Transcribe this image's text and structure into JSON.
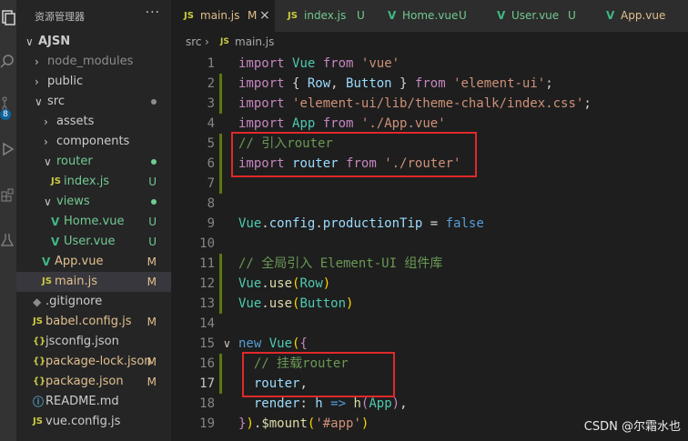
{
  "sidebar": {
    "title": "资源管理器",
    "more_glyph": "···",
    "badge": "8",
    "items": [
      {
        "label": "AJSN",
        "chev": "∨",
        "indent": 0,
        "bold": true
      },
      {
        "label": "node_modules",
        "chev": "›",
        "indent": 1,
        "dim": true
      },
      {
        "label": "public",
        "chev": "›",
        "indent": 1
      },
      {
        "label": "src",
        "chev": "∨",
        "indent": 1,
        "dot": "#8c8c8c"
      },
      {
        "label": "assets",
        "chev": "›",
        "indent": 2
      },
      {
        "label": "components",
        "chev": "›",
        "indent": 2
      },
      {
        "label": "router",
        "chev": "∨",
        "indent": 2,
        "dot": "#73c991",
        "color": "u"
      },
      {
        "label": "index.js",
        "icon": "JS",
        "indent": 3,
        "badge": "U",
        "color": "u"
      },
      {
        "label": "views",
        "chev": "∨",
        "indent": 2,
        "dot": "#73c991",
        "color": "u"
      },
      {
        "label": "Home.vue",
        "icon": "V",
        "indent": 3,
        "badge": "U",
        "color": "u"
      },
      {
        "label": "User.vue",
        "icon": "V",
        "indent": 3,
        "badge": "U",
        "color": "u"
      },
      {
        "label": "App.vue",
        "icon": "V",
        "indent": 2,
        "badge": "M",
        "color": "m"
      },
      {
        "label": "main.js",
        "icon": "JS",
        "indent": 2,
        "badge": "M",
        "color": "m",
        "active": true
      },
      {
        "label": ".gitignore",
        "icon": "◆",
        "indent": 1
      },
      {
        "label": "babel.config.js",
        "icon": "JS",
        "indent": 1,
        "badge": "M",
        "color": "m"
      },
      {
        "label": "jsconfig.json",
        "icon": "{}",
        "indent": 1
      },
      {
        "label": "package-lock.json",
        "icon": "{}",
        "indent": 1,
        "badge": "M",
        "color": "m"
      },
      {
        "label": "package.json",
        "icon": "{}",
        "indent": 1,
        "badge": "M",
        "color": "m"
      },
      {
        "label": "README.md",
        "icon": "ⓘ",
        "indent": 1
      },
      {
        "label": "vue.config.js",
        "icon": "JS",
        "indent": 1
      }
    ]
  },
  "tabs": [
    {
      "label": "main.js",
      "icon": "JS",
      "badge": "M",
      "close": "×",
      "active": true
    },
    {
      "label": "index.js",
      "icon": "JS",
      "badge": "U"
    },
    {
      "label": "Home.vue",
      "icon": "V",
      "badge": "U"
    },
    {
      "label": "User.vue",
      "icon": "V",
      "badge": "U"
    },
    {
      "label": "App.vue",
      "icon": "V",
      "badge": ""
    }
  ],
  "breadcrumb": {
    "folder": "src",
    "sep": "›",
    "icon": "JS",
    "file": "main.js"
  },
  "code_lines": [
    [
      [
        "kw",
        "import"
      ],
      [
        "pun",
        " "
      ],
      [
        "typ",
        "Vue"
      ],
      [
        "pun",
        " "
      ],
      [
        "kw",
        "from"
      ],
      [
        "pun",
        " "
      ],
      [
        "str",
        "'vue'"
      ]
    ],
    [
      [
        "kw",
        "import"
      ],
      [
        "pun",
        " { "
      ],
      [
        "id",
        "Row"
      ],
      [
        "pun",
        ", "
      ],
      [
        "id",
        "Button"
      ],
      [
        "pun",
        " } "
      ],
      [
        "kw",
        "from"
      ],
      [
        "pun",
        " "
      ],
      [
        "str",
        "'element-ui'"
      ],
      [
        "pun",
        ";"
      ]
    ],
    [
      [
        "kw",
        "import"
      ],
      [
        "pun",
        " "
      ],
      [
        "str",
        "'element-ui/lib/theme-chalk/index.css'"
      ],
      [
        "pun",
        ";"
      ]
    ],
    [
      [
        "kw",
        "import"
      ],
      [
        "pun",
        " "
      ],
      [
        "typ",
        "App"
      ],
      [
        "pun",
        " "
      ],
      [
        "kw",
        "from"
      ],
      [
        "pun",
        " "
      ],
      [
        "str",
        "'./App.vue'"
      ]
    ],
    [
      [
        "com",
        "// 引入router"
      ]
    ],
    [
      [
        "kw",
        "import"
      ],
      [
        "pun",
        " "
      ],
      [
        "id",
        "router"
      ],
      [
        "pun",
        " "
      ],
      [
        "kw",
        "from"
      ],
      [
        "pun",
        " "
      ],
      [
        "str",
        "'./router'"
      ]
    ],
    [],
    [],
    [
      [
        "typ",
        "Vue"
      ],
      [
        "pun",
        "."
      ],
      [
        "id",
        "config"
      ],
      [
        "pun",
        "."
      ],
      [
        "id",
        "productionTip"
      ],
      [
        "pun",
        " = "
      ],
      [
        "kw2",
        "false"
      ]
    ],
    [],
    [
      [
        "com",
        "// 全局引入 Element-UI 组件库"
      ]
    ],
    [
      [
        "typ",
        "Vue"
      ],
      [
        "pun",
        "."
      ],
      [
        "fn",
        "use"
      ],
      [
        "brk",
        "("
      ],
      [
        "typ",
        "Row"
      ],
      [
        "brk",
        ")"
      ]
    ],
    [
      [
        "typ",
        "Vue"
      ],
      [
        "pun",
        "."
      ],
      [
        "fn",
        "use"
      ],
      [
        "brk",
        "("
      ],
      [
        "typ",
        "Button"
      ],
      [
        "brk",
        ")"
      ]
    ],
    [],
    [
      [
        "kw2",
        "new"
      ],
      [
        "pun",
        " "
      ],
      [
        "typ",
        "Vue"
      ],
      [
        "brk",
        "("
      ],
      [
        "kw",
        "{"
      ]
    ],
    [
      [
        "pun",
        "  "
      ],
      [
        "com",
        "// 挂载router"
      ]
    ],
    [
      [
        "pun",
        "  "
      ],
      [
        "id",
        "router"
      ],
      [
        "pun",
        ","
      ]
    ],
    [
      [
        "pun",
        "  "
      ],
      [
        "id",
        "render"
      ],
      [
        "pun",
        ": "
      ],
      [
        "id",
        "h"
      ],
      [
        "pun",
        " "
      ],
      [
        "kw2",
        "=>"
      ],
      [
        "pun",
        " "
      ],
      [
        "fn",
        "h"
      ],
      [
        "kw",
        "("
      ],
      [
        "typ",
        "App"
      ],
      [
        "kw",
        ")"
      ],
      [
        "pun",
        ","
      ]
    ],
    [
      [
        "kw",
        "}"
      ],
      [
        "brk",
        ")"
      ],
      [
        "pun",
        "."
      ],
      [
        "fn",
        "$mount"
      ],
      [
        "brk",
        "("
      ],
      [
        "str",
        "'#app'"
      ],
      [
        "brk",
        ")"
      ]
    ]
  ],
  "watermark": "CSDN @尔霜水也"
}
